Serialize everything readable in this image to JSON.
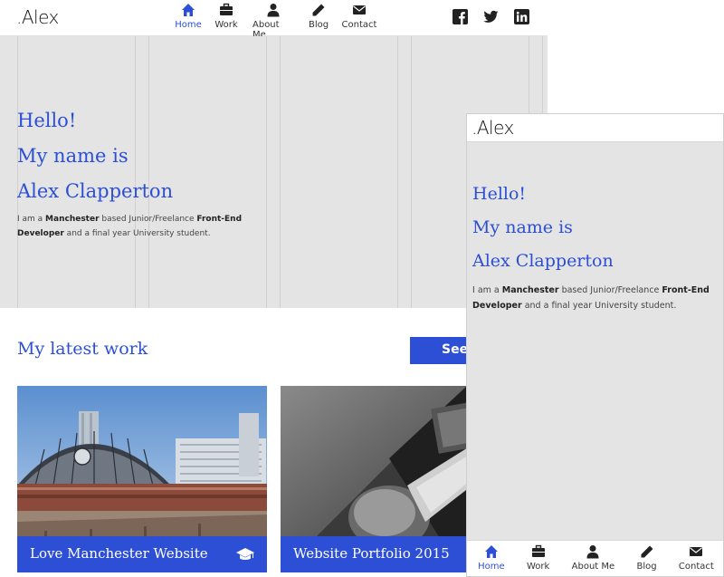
{
  "desktop": {
    "logo": ".Alex",
    "nav": [
      {
        "label": "Home",
        "icon": "home-icon",
        "active": true
      },
      {
        "label": "Work",
        "icon": "briefcase-icon"
      },
      {
        "label": "About Me",
        "icon": "user-icon"
      },
      {
        "label": "Blog",
        "icon": "pencil-icon"
      },
      {
        "label": "Contact",
        "icon": "envelope-icon"
      }
    ],
    "social": [
      "facebook-icon",
      "twitter-icon",
      "linkedin-icon"
    ],
    "hero": {
      "line1": "Hello!",
      "line2": "My name is",
      "line3": "Alex Clapperton",
      "sub_pre": "I am a ",
      "sub_city": "Manchester",
      "sub_mid": " based Junior/Freelance ",
      "sub_role": "Front-End Developer",
      "sub_post": " and a final year University student."
    },
    "work": {
      "title": "My latest work",
      "see_button": "See",
      "cards": [
        {
          "title": "Love Manchester Website",
          "icon": "graduation-cap-icon"
        },
        {
          "title": "Website Portfolio 2015"
        }
      ]
    }
  },
  "mobile": {
    "logo": ".Alex",
    "hero": {
      "line1": "Hello!",
      "line2": "My name is",
      "line3": "Alex Clapperton",
      "sub_pre": "I am a ",
      "sub_city": "Manchester",
      "sub_mid": " based Junior/Freelance ",
      "sub_role": "Front-End Developer",
      "sub_post": " and a final year University student."
    },
    "nav": [
      {
        "label": "Home",
        "icon": "home-icon",
        "active": true
      },
      {
        "label": "Work",
        "icon": "briefcase-icon"
      },
      {
        "label": "About Me",
        "icon": "user-icon"
      },
      {
        "label": "Blog",
        "icon": "pencil-icon"
      },
      {
        "label": "Contact",
        "icon": "envelope-icon"
      }
    ]
  },
  "colors": {
    "accent": "#2c4fd6",
    "hero_bg": "#e4e4e4",
    "text": "#333333"
  }
}
